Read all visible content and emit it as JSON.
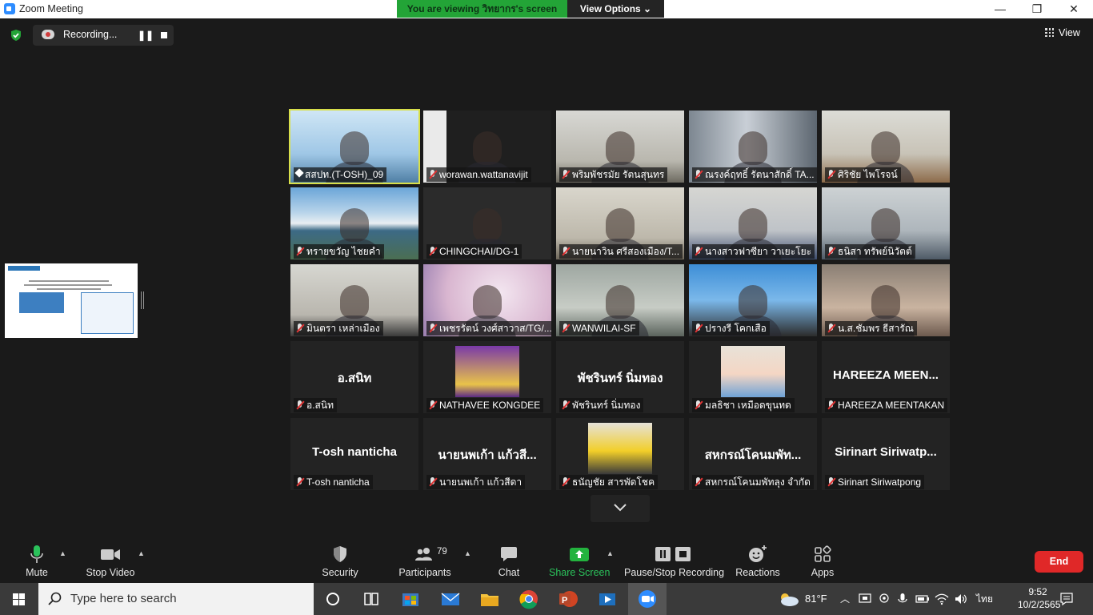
{
  "window": {
    "title": "Zoom Meeting",
    "minimize_glyph": "—",
    "restore_glyph": "❐",
    "close_glyph": "✕"
  },
  "banner": {
    "viewing_text": "You are viewing วิทยากร's screen",
    "view_options": "View Options ⌄"
  },
  "recording": {
    "label": "Recording...",
    "pause_glyph": "❚❚"
  },
  "view_button": "View",
  "gallery": {
    "tiles": [
      {
        "name": "สสปท.(T-OSH)_09",
        "pinned": true,
        "video": true
      },
      {
        "name": "worawan.wattanavijit",
        "muted": true,
        "video": true
      },
      {
        "name": "พริมพัชรมัย รัตนสุนทร",
        "muted": true,
        "video": true
      },
      {
        "name": "ณรงค์ฤทธิ์ รัตนาสักดิ์ TA...",
        "muted": true,
        "video": true
      },
      {
        "name": "ศิริชัย ไพโรจน์",
        "muted": true,
        "video": true
      },
      {
        "name": "ทรายขวัญ ไชยคำ",
        "muted": true,
        "video": true
      },
      {
        "name": "CHINGCHAI/DG-1",
        "muted": true,
        "video": true
      },
      {
        "name": "นายนาวิน ศรีสองเมือง/T...",
        "muted": true,
        "video": true
      },
      {
        "name": "นางสาวฟาซียา วาเยะโยะ",
        "muted": true,
        "video": true
      },
      {
        "name": "ธนิสา ทรัพย์นิวัตต์",
        "muted": true,
        "video": true
      },
      {
        "name": "มินตรา เหล่าเมือง",
        "muted": true,
        "video": true
      },
      {
        "name": "เพชรรัตน์ วงศ์สาวาส/TG/...",
        "muted": true,
        "video": true
      },
      {
        "name": "WANWILAI-SF",
        "muted": true,
        "video": true
      },
      {
        "name": "ปรางรี โคกเสือ",
        "muted": true,
        "video": true
      },
      {
        "name": "น.ส.ชัมพร ธีสารัณ",
        "muted": true,
        "video": true
      },
      {
        "name": "อ.สนิท",
        "big": "อ.สนิท",
        "muted": true
      },
      {
        "name": "NATHAVEE KONGDEE",
        "muted": true,
        "avatar": true
      },
      {
        "name": "พัชรินทร์ นิ่มทอง",
        "big": "พัชรินทร์ นิ่มทอง",
        "muted": true
      },
      {
        "name": "มลธิชา เหมือดขุนทด",
        "muted": true,
        "avatar": true
      },
      {
        "name": "HAREEZA MEENTAKAN",
        "big": "HAREEZA  MEEN...",
        "muted": true
      },
      {
        "name": "T-osh nanticha",
        "big": "T-osh nanticha",
        "muted": true
      },
      {
        "name": "นายนพเก้า  แก้วสีดา",
        "big": "นายนพเก้า  แก้วสี...",
        "muted": true
      },
      {
        "name": "ธนัญชัย สารพัดโชค",
        "muted": true,
        "avatar": true
      },
      {
        "name": "สหกรณ์โคนมพัทลุง จำกัด",
        "big": "สหกรณ์โคนมพัท...",
        "muted": true
      },
      {
        "name": "Sirinart Siriwatpong",
        "big": "Sirinart  Siriwatp...",
        "muted": true
      }
    ]
  },
  "toolbar": {
    "mute": "Mute",
    "stop_video": "Stop Video",
    "security": "Security",
    "participants": "Participants",
    "participants_count": "79",
    "chat": "Chat",
    "share_screen": "Share Screen",
    "recording": "Pause/Stop Recording",
    "reactions": "Reactions",
    "apps": "Apps",
    "end": "End"
  },
  "taskbar": {
    "search_placeholder": "Type here to search",
    "temperature": "81°F",
    "language": "ไทย",
    "time": "9:52",
    "date": "10/2/2565"
  },
  "colors": {
    "banner_green": "#23a437",
    "end_red": "#e02828",
    "pinned_outline": "#d8df4a",
    "muted_icon": "#e03535"
  }
}
